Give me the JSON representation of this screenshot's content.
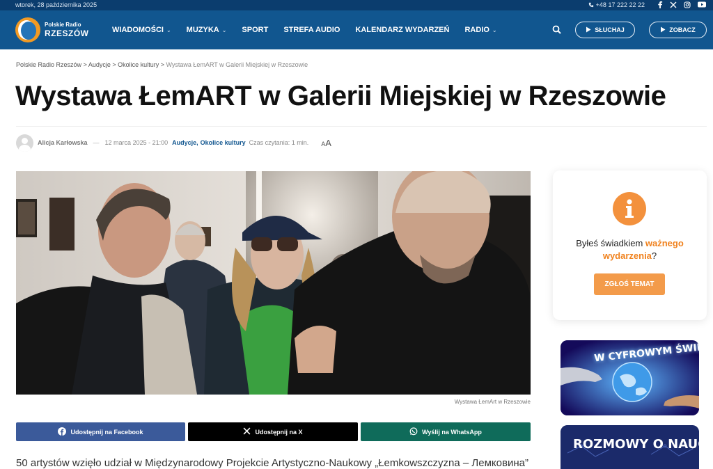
{
  "topbar": {
    "date": "wtorek, 28 października 2025",
    "phone": "+48 17 222 22 22",
    "social_icons": [
      "facebook-icon",
      "x-icon",
      "instagram-icon",
      "youtube-icon"
    ]
  },
  "logo": {
    "line1": "Polskie Radio",
    "line2": "RZESZÓW"
  },
  "nav": {
    "items": [
      {
        "label": "WIADOMOŚCI",
        "has_dropdown": true
      },
      {
        "label": "MUZYKA",
        "has_dropdown": true
      },
      {
        "label": "SPORT",
        "has_dropdown": false
      },
      {
        "label": "STREFA AUDIO",
        "has_dropdown": false
      },
      {
        "label": "KALENDARZ WYDARZEŃ",
        "has_dropdown": false
      },
      {
        "label": "RADIO",
        "has_dropdown": true
      }
    ],
    "listen_label": "SŁUCHAJ",
    "watch_label": "ZOBACZ"
  },
  "breadcrumb": {
    "items": [
      "Polskie Radio Rzeszów",
      "Audycje",
      "Okolice kultury"
    ],
    "separator": ">",
    "current": "Wystawa ŁemART w Galerii Miejskiej w Rzeszowie"
  },
  "article": {
    "title": "Wystawa ŁemART w Galerii Miejskiej w Rzeszowie",
    "author": "Alicja Karłowska",
    "author_sep": "—",
    "date": "12 marca 2025 - 21:00",
    "categories": [
      "Audycje",
      "Okolice kultury"
    ],
    "category_sep": ",",
    "reading_time": "Czas czytania: 1 min.",
    "font_size_small": "A",
    "font_size_large": "A",
    "image_caption": "Wystawa ŁemArt w Rzeszowie",
    "lead": "50 artystów wzięło udział w Międzynarodowy Projekcie Artystyczno-Naukowy „Łemkowszczyzna – Лемковина”"
  },
  "share": {
    "facebook": "Udostępnij na Facebook",
    "x": "Udostępnij na X",
    "whatsapp": "Wyślij na WhatsApp"
  },
  "sidebar": {
    "widget": {
      "text_before": "Byłeś świadkiem ",
      "highlight": "ważnego wydarzenia",
      "text_after": "?",
      "button": "ZGŁOŚ TEMAT",
      "accent_color": "#f0821e"
    },
    "promo1_title": "W CYFROWYM ŚWIECIE",
    "promo2_title": "ROZMOWY O NAUCE"
  },
  "colors": {
    "topbar": "#0b3d6e",
    "nav": "#11568f",
    "facebook": "#3b5a9a",
    "x": "#000000",
    "whatsapp": "#0f6b5a",
    "cta": "#f39b4a"
  }
}
